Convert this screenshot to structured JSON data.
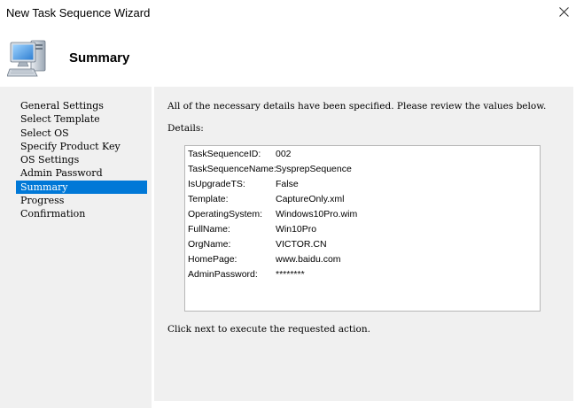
{
  "window": {
    "title": "New Task Sequence Wizard",
    "close_icon": "close-icon"
  },
  "header": {
    "title": "Summary",
    "icon": "computer-icon"
  },
  "nav": {
    "items": [
      {
        "label": "General Settings",
        "active": false
      },
      {
        "label": "Select Template",
        "active": false
      },
      {
        "label": "Select OS",
        "active": false
      },
      {
        "label": "Specify Product Key",
        "active": false
      },
      {
        "label": "OS Settings",
        "active": false
      },
      {
        "label": "Admin Password",
        "active": false
      },
      {
        "label": "Summary",
        "active": true
      },
      {
        "label": "Progress",
        "active": false
      },
      {
        "label": "Confirmation",
        "active": false
      }
    ]
  },
  "content": {
    "intro": "All of the necessary details have been specified.  Please review the values below.",
    "details_label": "Details:",
    "footer": "Click next to execute the requested action.",
    "details": [
      {
        "key": "TaskSequenceID:",
        "value": "002"
      },
      {
        "key": "TaskSequenceName:",
        "value": "SysprepSequence"
      },
      {
        "key": "IsUpgradeTS:",
        "value": "False"
      },
      {
        "key": "Template:",
        "value": "CaptureOnly.xml"
      },
      {
        "key": "OperatingSystem:",
        "value": "Windows10Pro.wim"
      },
      {
        "key": "FullName:",
        "value": "Win10Pro"
      },
      {
        "key": "OrgName:",
        "value": "VICTOR.CN"
      },
      {
        "key": "HomePage:",
        "value": "www.baidu.com"
      },
      {
        "key": "AdminPassword:",
        "value": "********"
      }
    ]
  },
  "colors": {
    "selection": "#0078d7",
    "pane_background": "#f0f0f0"
  }
}
